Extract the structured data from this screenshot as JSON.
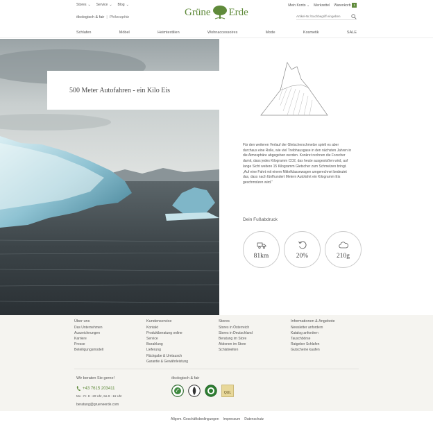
{
  "header": {
    "topnav": [
      {
        "label": "Stores"
      },
      {
        "label": "Service"
      },
      {
        "label": "Blog"
      }
    ],
    "tagline": "ökologisch & fair",
    "philosophy": "Philosophie",
    "logo_left": "Grüne",
    "logo_right": "Erde",
    "account": "Mein Konto",
    "wishlist": "Merkzettel",
    "basket": "Warenkorb",
    "basket_count": "1",
    "search_placeholder": "Artikel-Nr./Suchbegriff eingeben"
  },
  "mainnav": [
    "Schlafen",
    "Möbel",
    "Heimtextilien",
    "Wohnaccessoires",
    "Mode",
    "Kosmetik",
    "SALE"
  ],
  "article": {
    "title": "500 Meter Autofahren - ein Kilo Eis",
    "body": "Für den weiteren Verlauf der Gletscherschmelze spielt es aber durchaus eine Rolle, wie viel Treibhausgase in den nächsten Jahren in die Atmosphäre abgegeben werden. Konkret rechnen die Forscher damit, dass jedes Kilogramm CO2, das heute ausgestoßen wird, auf lange Sicht weitere 15 Kilogramm Gletscher zum Schmelzen bringt. „Auf eine Fahrt mit einem Mittelklassewagen umgerechnet bedeutet das, dass nach fünfhundert Metern Autofahrt ein Kilogramm Eis geschmolzen wird.“"
  },
  "footprint": {
    "title": "Dein Fußabdruck",
    "items": [
      {
        "icon": "truck-icon",
        "value": "81km"
      },
      {
        "icon": "recycle-arrow-icon",
        "value": "20%"
      },
      {
        "icon": "cloud-icon",
        "value": "210g"
      }
    ]
  },
  "footer": {
    "about": {
      "title": "Über uns",
      "links": [
        "Das Unternehmen",
        "Auszeichnungen",
        "Karriere",
        "Presse",
        "Beteiligungsmodell"
      ]
    },
    "service": {
      "title": "Kundenservice",
      "links": [
        "Kontakt",
        "Produktberatung online",
        "Service",
        "Bezahlung",
        "Lieferung",
        "Rückgabe & Umtausch",
        "Garantie & Gewährleistung"
      ]
    },
    "stores": {
      "title": "Stores",
      "links": [
        "Stores in Österreich",
        "Stores in Deutschland",
        "Beratung im Store",
        "Aktionen im Store",
        "Schlafwelten"
      ]
    },
    "info": {
      "title": "Informationen & Angebote",
      "links": [
        "Newsletter anfordern",
        "Katalog anfordern",
        "Tauschbörse",
        "Ratgeber Schlafen",
        "Gutscheine kaufen"
      ]
    },
    "advice_title": "Wir beraten Sie gerne!",
    "phone": "+43 7615 203411",
    "hours": "Mo - Fr. 8 - 20 Uhr, Sa 9 - 16 Uhr",
    "email": "beratung@grueneerde.com",
    "eco_title": "ökologisch & fair",
    "badge_text": "QUL"
  },
  "legal": [
    "Allgem. Geschäftsbedingungen",
    "Impressum",
    "Datenschutz"
  ],
  "colors": {
    "brand_green": "#5f8a3a",
    "footer_bg": "#f5f4f0"
  }
}
